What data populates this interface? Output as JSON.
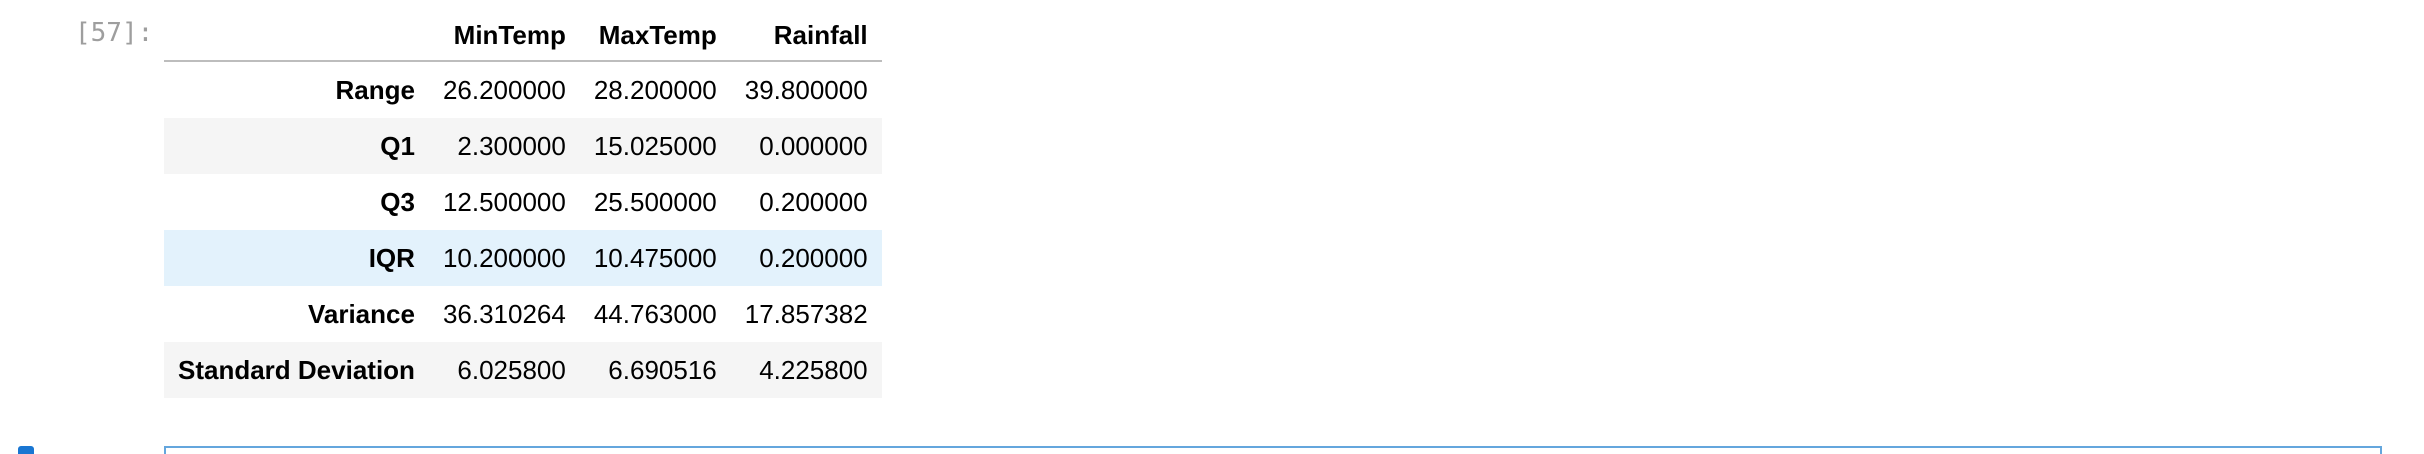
{
  "cell": {
    "execution_prompt": "[57]:"
  },
  "table": {
    "columns": [
      "",
      "MinTemp",
      "MaxTemp",
      "Rainfall"
    ],
    "rows": [
      {
        "label": "Range",
        "values": [
          "26.200000",
          "28.200000",
          "39.800000"
        ]
      },
      {
        "label": "Q1",
        "values": [
          "2.300000",
          "15.025000",
          "0.000000"
        ]
      },
      {
        "label": "Q3",
        "values": [
          "12.500000",
          "25.500000",
          "0.200000"
        ]
      },
      {
        "label": "IQR",
        "values": [
          "10.200000",
          "10.475000",
          "0.200000"
        ]
      },
      {
        "label": "Variance",
        "values": [
          "36.310264",
          "44.763000",
          "17.857382"
        ]
      },
      {
        "label": "Standard Deviation",
        "values": [
          "6.025800",
          "6.690516",
          "4.225800"
        ]
      }
    ]
  },
  "colors": {
    "prompt": "#9e9e9e",
    "stripe": "#f5f5f5",
    "hover_row": "#e3f2fc",
    "active_cell_border": "#64a6dd",
    "cell_marker": "#1976d2"
  }
}
